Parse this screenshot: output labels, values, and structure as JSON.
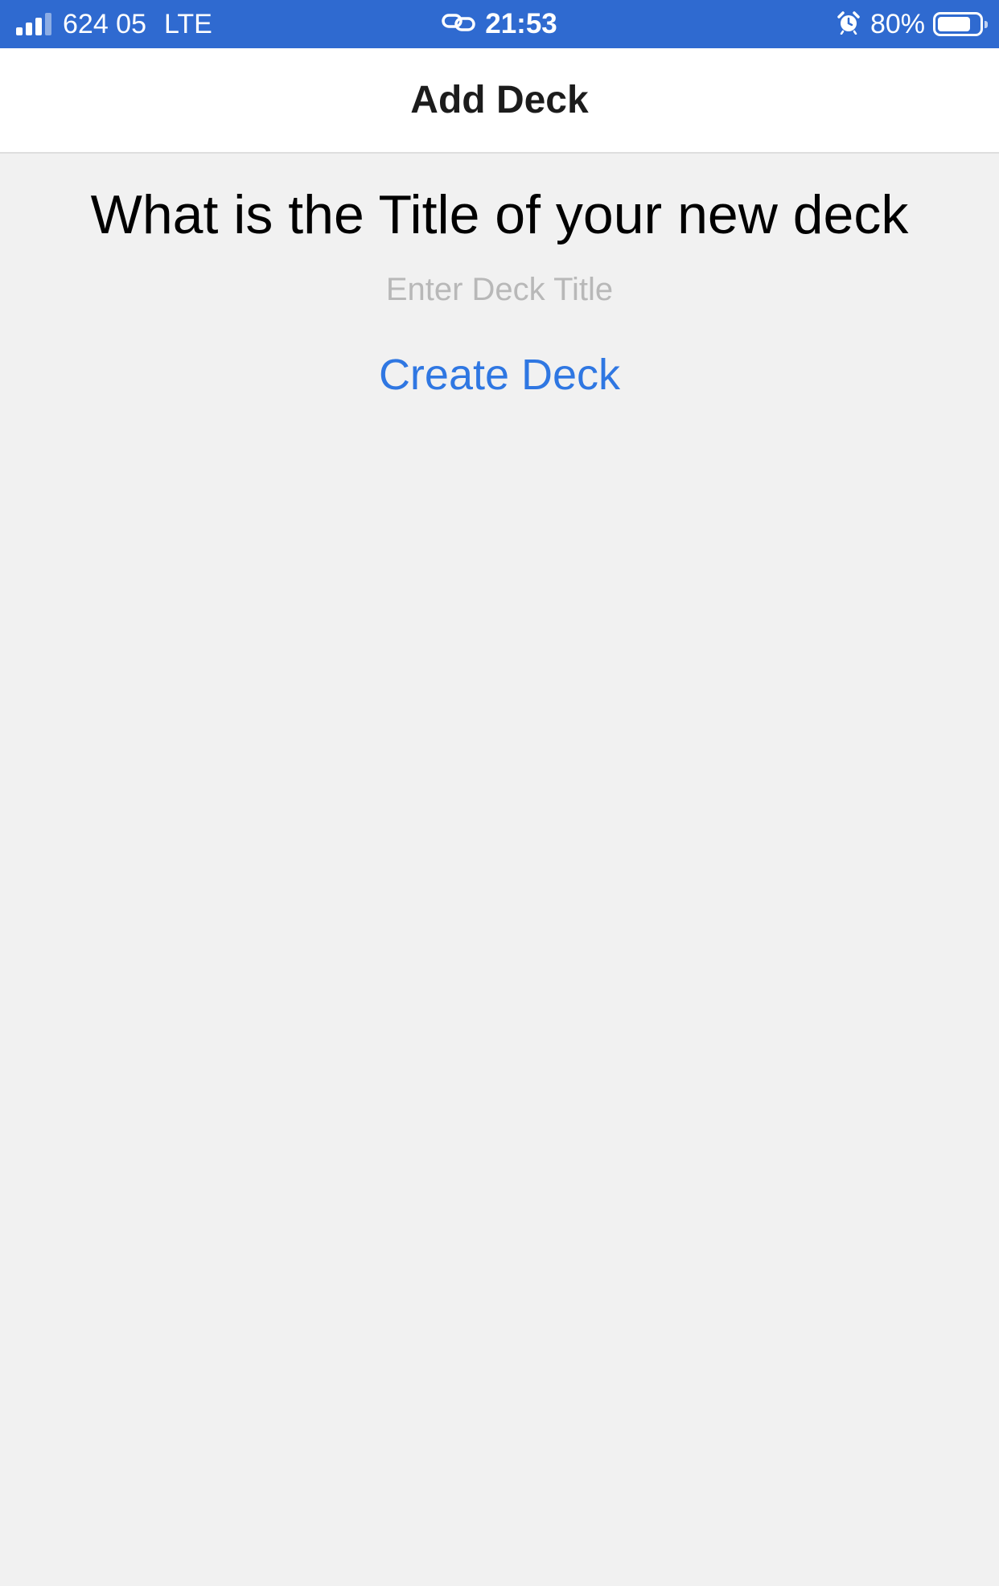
{
  "status_bar": {
    "carrier": "624 05",
    "network": "LTE",
    "time": "21:53",
    "battery_percent_label": "80%",
    "battery_level": 0.8,
    "icons": [
      "signal-icon",
      "link-icon",
      "alarm-icon",
      "battery-icon"
    ],
    "background_color": "#2f6ad0"
  },
  "nav": {
    "title": "Add Deck"
  },
  "form": {
    "question": "What is the Title of your new deck",
    "title_input": {
      "value": "",
      "placeholder": "Enter Deck Title"
    },
    "create_button_label": "Create Deck",
    "accent_color": "#2f77e2"
  }
}
